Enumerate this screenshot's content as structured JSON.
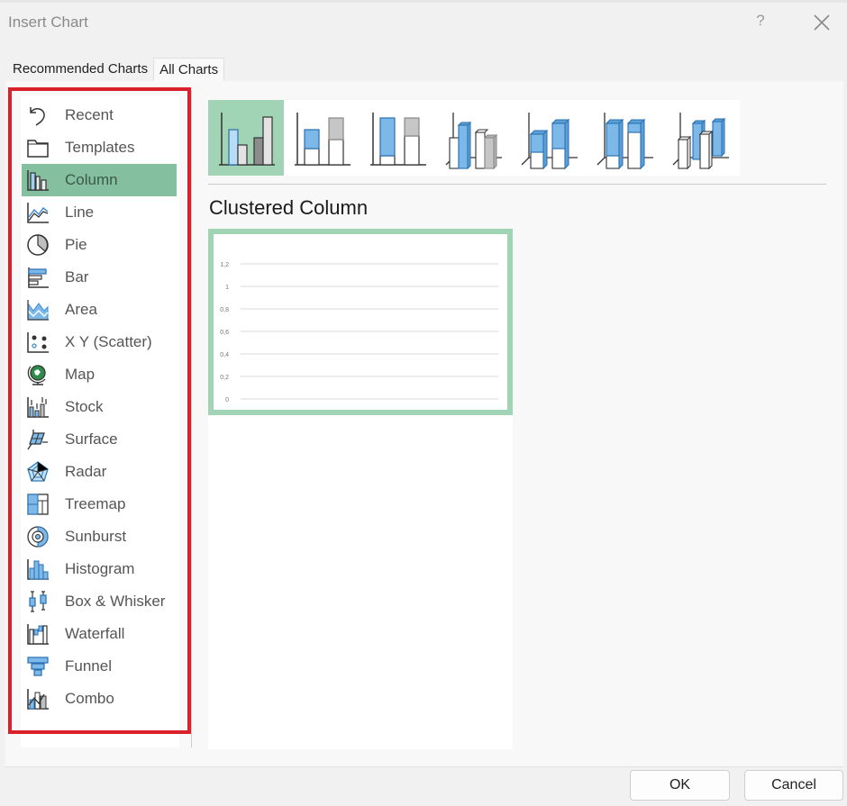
{
  "dialog": {
    "title": "Insert Chart",
    "help_label": "?",
    "close_icon": "close-icon"
  },
  "tabs": [
    {
      "label": "Recommended Charts",
      "active": false
    },
    {
      "label": "All Charts",
      "active": true
    }
  ],
  "sidebar": {
    "items": [
      {
        "label": "Recent",
        "icon": "undo-arrow-icon",
        "active": false
      },
      {
        "label": "Templates",
        "icon": "folder-icon",
        "active": false
      },
      {
        "label": "Column",
        "icon": "column-chart-icon",
        "active": true
      },
      {
        "label": "Line",
        "icon": "line-chart-icon",
        "active": false
      },
      {
        "label": "Pie",
        "icon": "pie-chart-icon",
        "active": false
      },
      {
        "label": "Bar",
        "icon": "bar-chart-icon",
        "active": false
      },
      {
        "label": "Area",
        "icon": "area-chart-icon",
        "active": false
      },
      {
        "label": "X Y (Scatter)",
        "icon": "scatter-chart-icon",
        "active": false
      },
      {
        "label": "Map",
        "icon": "globe-icon",
        "active": false
      },
      {
        "label": "Stock",
        "icon": "stock-chart-icon",
        "active": false
      },
      {
        "label": "Surface",
        "icon": "surface-chart-icon",
        "active": false
      },
      {
        "label": "Radar",
        "icon": "radar-chart-icon",
        "active": false
      },
      {
        "label": "Treemap",
        "icon": "treemap-icon",
        "active": false
      },
      {
        "label": "Sunburst",
        "icon": "sunburst-icon",
        "active": false
      },
      {
        "label": "Histogram",
        "icon": "histogram-icon",
        "active": false
      },
      {
        "label": "Box & Whisker",
        "icon": "box-whisker-icon",
        "active": false
      },
      {
        "label": "Waterfall",
        "icon": "waterfall-icon",
        "active": false
      },
      {
        "label": "Funnel",
        "icon": "funnel-icon",
        "active": false
      },
      {
        "label": "Combo",
        "icon": "combo-chart-icon",
        "active": false
      }
    ]
  },
  "subtypes": [
    {
      "name": "Clustered Column",
      "icon": "clustered-column-icon",
      "active": true
    },
    {
      "name": "Stacked Column",
      "icon": "stacked-column-icon",
      "active": false
    },
    {
      "name": "100% Stacked Column",
      "icon": "100-stacked-column-icon",
      "active": false
    },
    {
      "name": "3-D Clustered Column",
      "icon": "3d-clustered-column-icon",
      "active": false
    },
    {
      "name": "3-D Stacked Column",
      "icon": "3d-stacked-column-icon",
      "active": false
    },
    {
      "name": "3-D 100% Stacked Column",
      "icon": "3d-100-stacked-column-icon",
      "active": false
    },
    {
      "name": "3-D Column",
      "icon": "3d-column-icon",
      "active": false
    }
  ],
  "selected_subtype_title": "Clustered Column",
  "preview": {
    "y_ticks": [
      "1,2",
      "1",
      "0,8",
      "0,6",
      "0,4",
      "0,2",
      "0"
    ]
  },
  "footer": {
    "ok_label": "OK",
    "cancel_label": "Cancel"
  },
  "colors": {
    "selection_green": "#84bf9f",
    "subtype_green": "#a0d4b4",
    "highlight_red": "#d9202b",
    "chart_blue": "#7cb8e8"
  }
}
